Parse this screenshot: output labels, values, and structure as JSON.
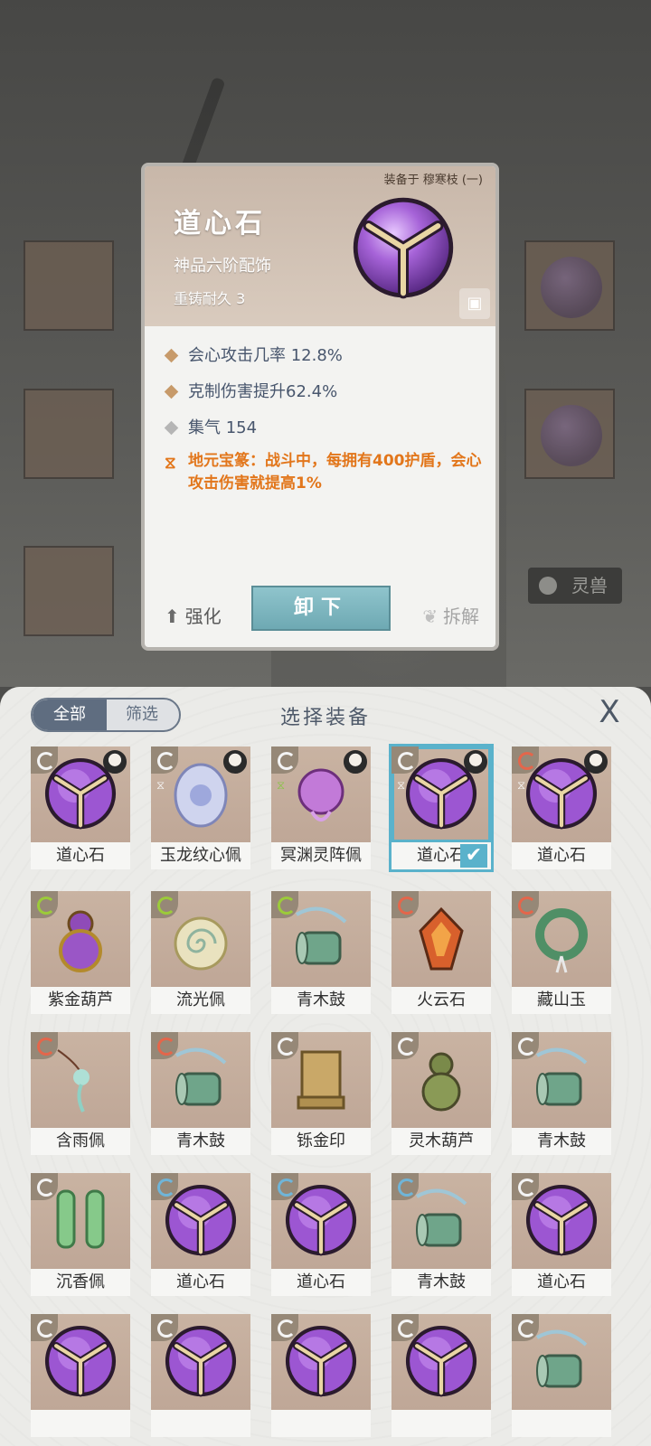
{
  "detail": {
    "equipped_on": "装备于 穆寒枝 (一)",
    "name": "道心石",
    "grade": "神品六阶配饰",
    "reforge": "重铸耐久 3",
    "stats": [
      {
        "text": "会心攻击几率 12.8%",
        "color": "#c79a6a"
      },
      {
        "text": "克制伤害提升62.4%",
        "color": "#c79a6a"
      },
      {
        "text": "集气 154",
        "color": "#b5b5b5"
      }
    ],
    "set_bonus": "地元宝篆：战斗中，每拥有400护盾，会心攻击伤害就提高1%",
    "actions": {
      "enhance": "强化",
      "unequip": "卸下",
      "dismantle": "拆解"
    }
  },
  "background": {
    "beast_tag": "灵兽"
  },
  "sheet": {
    "filter_all": "全部",
    "filter_filter": "筛选",
    "title": "选择装备",
    "close": "X",
    "items": [
      {
        "name": "道心石",
        "kind": "orb",
        "type": "white",
        "avatar": true,
        "selected": false
      },
      {
        "name": "玉龙纹心佩",
        "kind": "jade",
        "type": "white",
        "avatar": true,
        "selected": false
      },
      {
        "name": "冥渊灵阵佩",
        "kind": "purple-charm",
        "type": "white",
        "avatar": true,
        "selected": false
      },
      {
        "name": "道心石",
        "kind": "orb",
        "type": "white",
        "avatar": true,
        "selected": true
      },
      {
        "name": "道心石",
        "kind": "orb",
        "type": "red",
        "avatar": true,
        "selected": false
      },
      {
        "name": "紫金葫芦",
        "kind": "gourd-purple",
        "type": "green",
        "avatar": false,
        "selected": false
      },
      {
        "name": "流光佩",
        "kind": "spiral",
        "type": "green",
        "avatar": false,
        "selected": false
      },
      {
        "name": "青木鼓",
        "kind": "drum",
        "type": "green",
        "avatar": false,
        "selected": false
      },
      {
        "name": "火云石",
        "kind": "fire-stone",
        "type": "red",
        "avatar": false,
        "selected": false
      },
      {
        "name": "藏山玉",
        "kind": "jade-ring",
        "type": "red",
        "avatar": false,
        "selected": false
      },
      {
        "name": "含雨佩",
        "kind": "tassel",
        "type": "red",
        "avatar": false,
        "selected": false
      },
      {
        "name": "青木鼓",
        "kind": "drum",
        "type": "red",
        "avatar": false,
        "selected": false
      },
      {
        "name": "铄金印",
        "kind": "seal",
        "type": "white",
        "avatar": false,
        "selected": false
      },
      {
        "name": "灵木葫芦",
        "kind": "gourd-green",
        "type": "white",
        "avatar": false,
        "selected": false
      },
      {
        "name": "青木鼓",
        "kind": "drum",
        "type": "white",
        "avatar": false,
        "selected": false
      },
      {
        "name": "沉香佩",
        "kind": "green-chain",
        "type": "white",
        "avatar": false,
        "selected": false
      },
      {
        "name": "道心石",
        "kind": "orb",
        "type": "blue",
        "avatar": false,
        "selected": false
      },
      {
        "name": "道心石",
        "kind": "orb",
        "type": "blue",
        "avatar": false,
        "selected": false
      },
      {
        "name": "青木鼓",
        "kind": "drum",
        "type": "blue",
        "avatar": false,
        "selected": false
      },
      {
        "name": "道心石",
        "kind": "orb",
        "type": "white",
        "avatar": false,
        "selected": false
      },
      {
        "name": "",
        "kind": "orb",
        "type": "white",
        "avatar": false,
        "selected": false
      },
      {
        "name": "",
        "kind": "orb",
        "type": "white",
        "avatar": false,
        "selected": false
      },
      {
        "name": "",
        "kind": "orb",
        "type": "white",
        "avatar": false,
        "selected": false
      },
      {
        "name": "",
        "kind": "orb",
        "type": "white",
        "avatar": false,
        "selected": false
      },
      {
        "name": "",
        "kind": "drum",
        "type": "white",
        "avatar": false,
        "selected": false
      }
    ]
  }
}
